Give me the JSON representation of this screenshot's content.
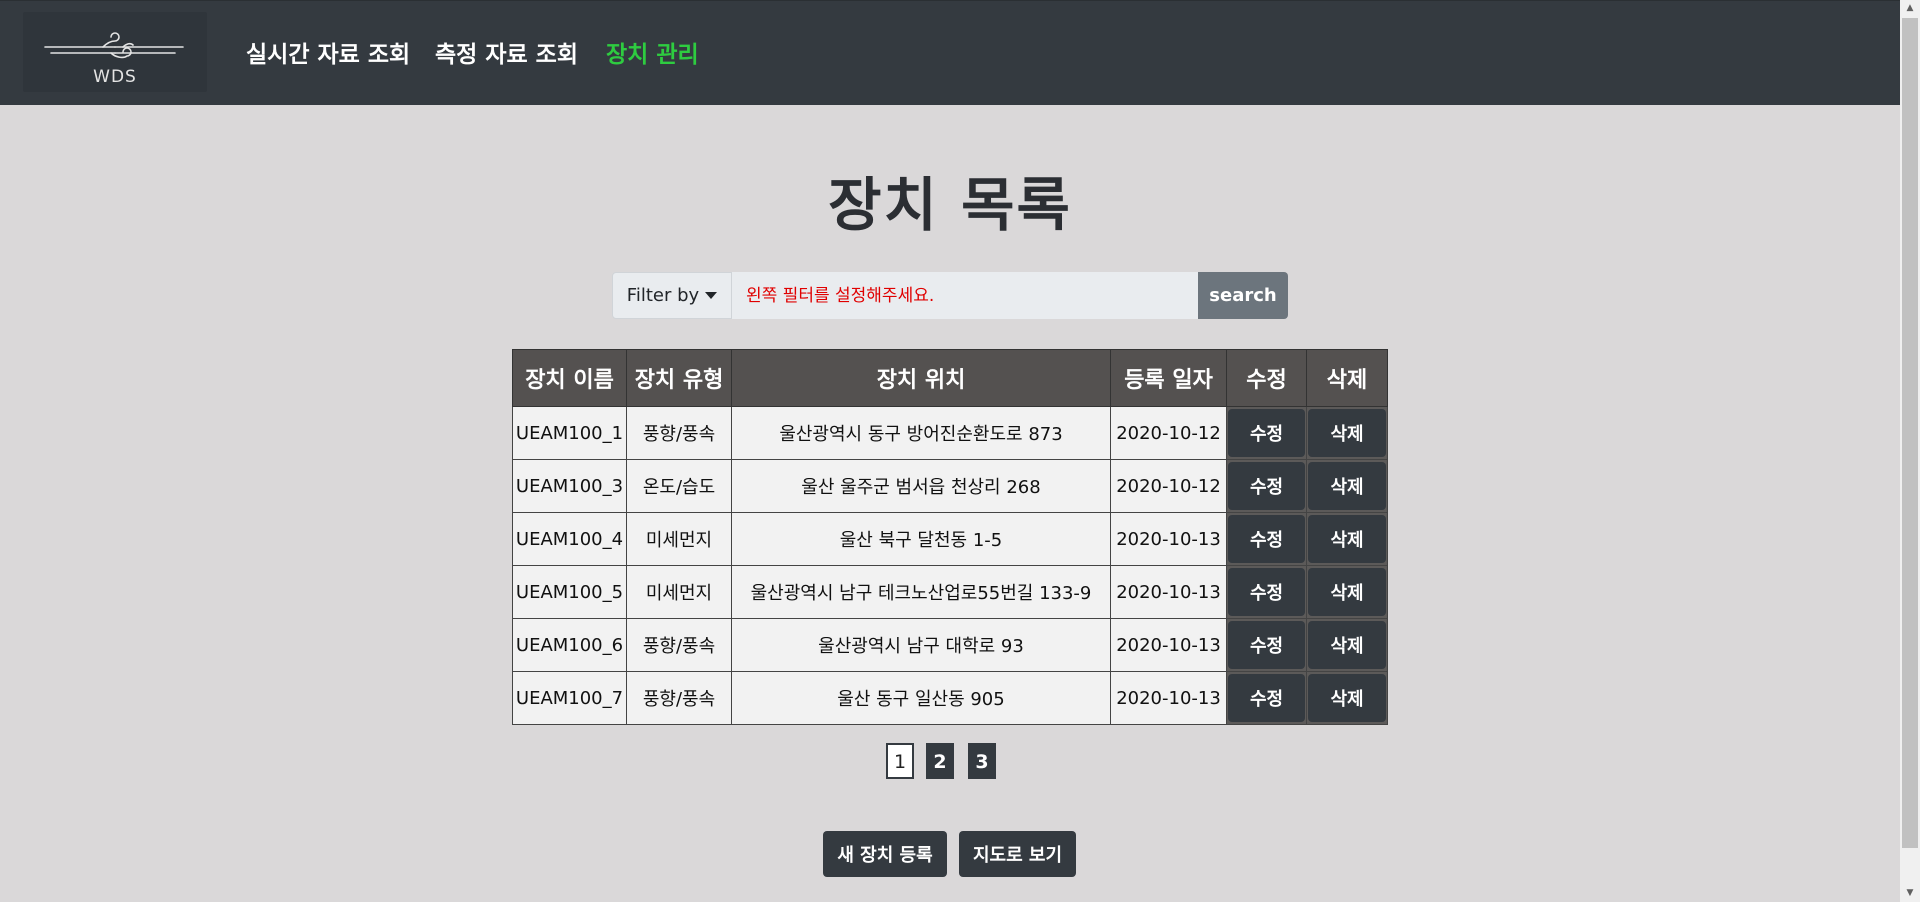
{
  "nav": {
    "logo_text": "WDS",
    "links": [
      "실시간 자료 조회",
      "측정 자료 조회",
      "장치 관리"
    ],
    "active_color": "#2ecc40"
  },
  "page": {
    "title": "장치 목록"
  },
  "search": {
    "filter_label": "Filter by",
    "placeholder": "왼쪽 필터를 설정해주세요.",
    "button_label": "search"
  },
  "table": {
    "headers": [
      "장치 이름",
      "장치 유형",
      "장치 위치",
      "등록 일자",
      "수정",
      "삭제"
    ],
    "edit_label": "수정",
    "delete_label": "삭제",
    "rows": [
      {
        "name": "UEAM100_1",
        "type": "풍향/풍속",
        "location": "울산광역시 동구 방어진순환도로 873",
        "date": "2020-10-12"
      },
      {
        "name": "UEAM100_3",
        "type": "온도/습도",
        "location": "울산 울주군 범서읍 천상리 268",
        "date": "2020-10-12"
      },
      {
        "name": "UEAM100_4",
        "type": "미세먼지",
        "location": "울산 북구 달천동 1-5",
        "date": "2020-10-13"
      },
      {
        "name": "UEAM100_5",
        "type": "미세먼지",
        "location": "울산광역시 남구 테크노산업로55번길 133-9",
        "date": "2020-10-13"
      },
      {
        "name": "UEAM100_6",
        "type": "풍향/풍속",
        "location": "울산광역시 남구 대학로 93",
        "date": "2020-10-13"
      },
      {
        "name": "UEAM100_7",
        "type": "풍향/풍속",
        "location": "울산 동구 일산동 905",
        "date": "2020-10-13"
      }
    ]
  },
  "pagination": {
    "pages": [
      "1",
      "2",
      "3"
    ],
    "current": "1"
  },
  "actions": {
    "register_label": "새 장치 등록",
    "map_label": "지도로 보기"
  }
}
